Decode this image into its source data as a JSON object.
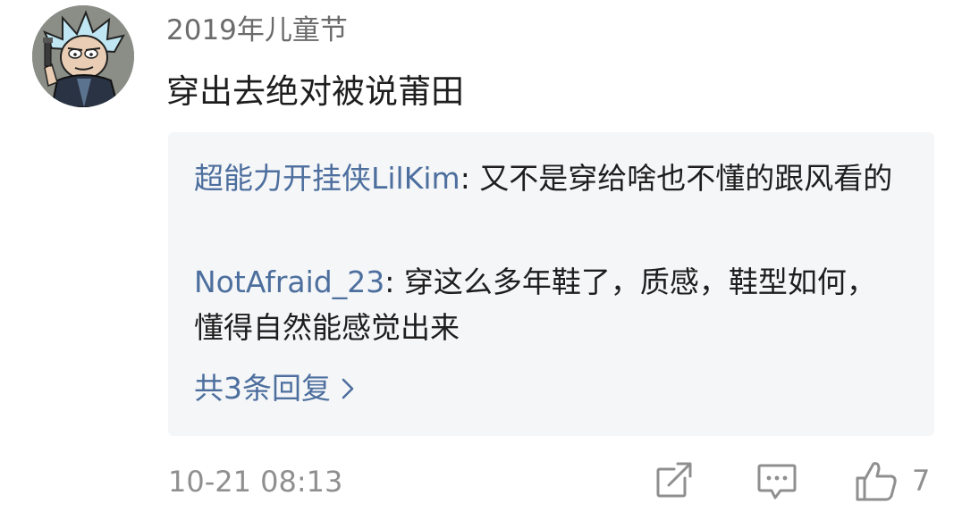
{
  "comment": {
    "username": "2019年儿童节",
    "text": "穿出去绝对被说莆田",
    "timestamp": "10-21 08:13"
  },
  "replies": [
    {
      "author": "超能力开挂侠LilKim",
      "separator": ": ",
      "text": "又不是穿给啥也不懂的跟风看的"
    },
    {
      "author": "NotAfraid_23",
      "separator": ": ",
      "text": "穿这么多年鞋了，质感，鞋型如何，懂得自然能感觉出来"
    }
  ],
  "more_replies_label": "共3条回复",
  "more_replies_icon": "chevron-right-icon",
  "actions": {
    "share_icon": "share-icon",
    "reply_icon": "comment-icon",
    "like_icon": "thumbs-up-icon",
    "like_count": "7"
  },
  "colors": {
    "link": "#4d6f9e",
    "text": "#1e1e1e",
    "meta": "#8f8f8f",
    "reply_bg": "#f5f6f8"
  }
}
